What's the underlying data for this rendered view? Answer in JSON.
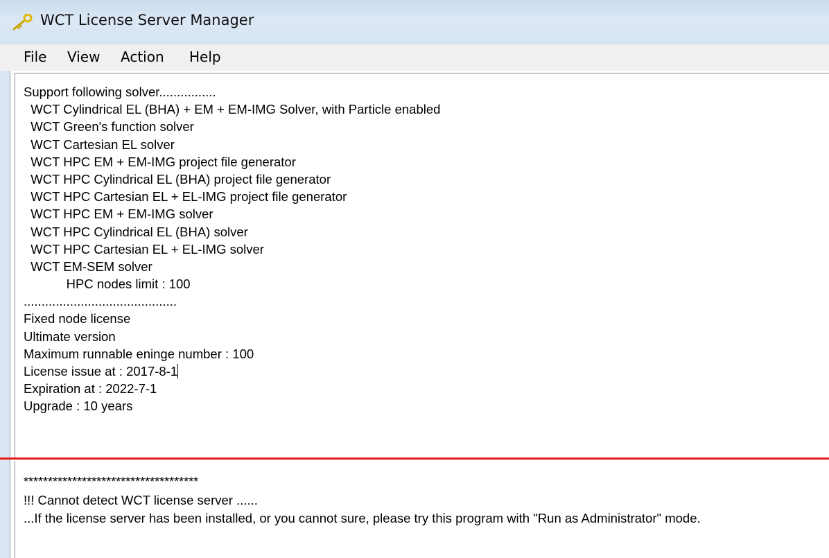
{
  "window": {
    "title": "WCT License Server Manager",
    "icon": "key-icon"
  },
  "menu": [
    "File",
    "View",
    "Action",
    "Help"
  ],
  "license_text": [
    "Support following solver................",
    "  WCT Cylindrical EL (BHA) + EM + EM-IMG Solver, with Particle enabled",
    "  WCT Green's function solver",
    "  WCT Cartesian EL solver",
    "  WCT HPC EM + EM-IMG project file generator",
    "  WCT HPC Cylindrical EL (BHA) project file generator",
    "  WCT HPC Cartesian EL + EL-IMG project file generator",
    "  WCT HPC EM + EM-IMG solver",
    "  WCT HPC Cylindrical EL (BHA) solver",
    "  WCT HPC Cartesian EL + EL-IMG solver",
    "  WCT EM-SEM solver",
    "            HPC nodes limit : 100",
    "...........................................",
    "Fixed node license",
    "Ultimate version",
    "Maximum runnable eninge number : 100",
    "License issue at : 2017-8-1",
    "Expiration at : 2022-7-1",
    "Upgrade : 10 years"
  ],
  "status": {
    "separator": "************************************",
    "error": "!!! Cannot detect WCT license server ......",
    "hint": "...If the license server has been installed, or you cannot sure, please try this program with \"Run as Administrator\" mode."
  },
  "colors": {
    "titlebar": "#d6e4f2",
    "menubar": "#f0f0f0",
    "divider": "#e81b1b",
    "text": "#000000"
  }
}
